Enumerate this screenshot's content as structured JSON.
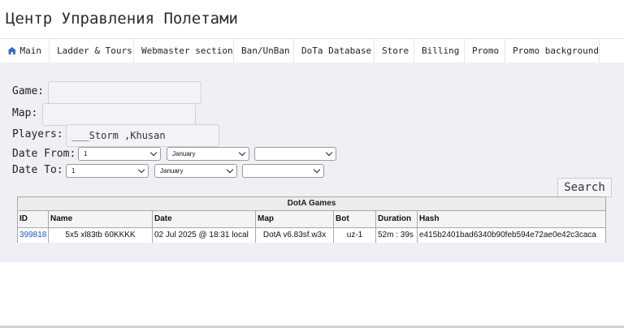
{
  "header": {
    "title": "Центр Управления Полетами"
  },
  "nav": {
    "items": [
      {
        "label": "Main",
        "icon": "home-icon"
      },
      {
        "label": "Ladder & Tours"
      },
      {
        "label": "Webmaster section"
      },
      {
        "label": "Ban/UnBan"
      },
      {
        "label": "DoTa Database"
      },
      {
        "label": "Store"
      },
      {
        "label": "Billing"
      },
      {
        "label": "Promo"
      },
      {
        "label": "Promo background"
      }
    ]
  },
  "form": {
    "game_label": "Game:",
    "game_value": "",
    "map_label": "Map:",
    "map_value": "",
    "players_label": "Players:",
    "players_value": "___Storm ,Khusan",
    "date_from_label": "Date From:",
    "date_from": {
      "day": "1",
      "month": "January",
      "year": ""
    },
    "date_to_label": "Date To:",
    "date_to": {
      "day": "1",
      "month": "January",
      "year": ""
    },
    "search_label": "Search"
  },
  "table": {
    "caption": "DotA Games",
    "columns": [
      "ID",
      "Name",
      "Date",
      "Map",
      "Bot",
      "Duration",
      "Hash"
    ],
    "rows": [
      [
        "399818",
        "5x5 xl83tb 60KKKK",
        "02 Jul 2025 @ 18:31 local",
        "DotA v6.83sf.w3x",
        "uz-1",
        "52m : 39s",
        "e415b2401bad6340b90feb594e72ae0e42c3caca"
      ]
    ]
  },
  "colors": {
    "link": "#1a57c4",
    "panel_bg": "#eef0f5",
    "home_icon": "#2a6fd6"
  }
}
